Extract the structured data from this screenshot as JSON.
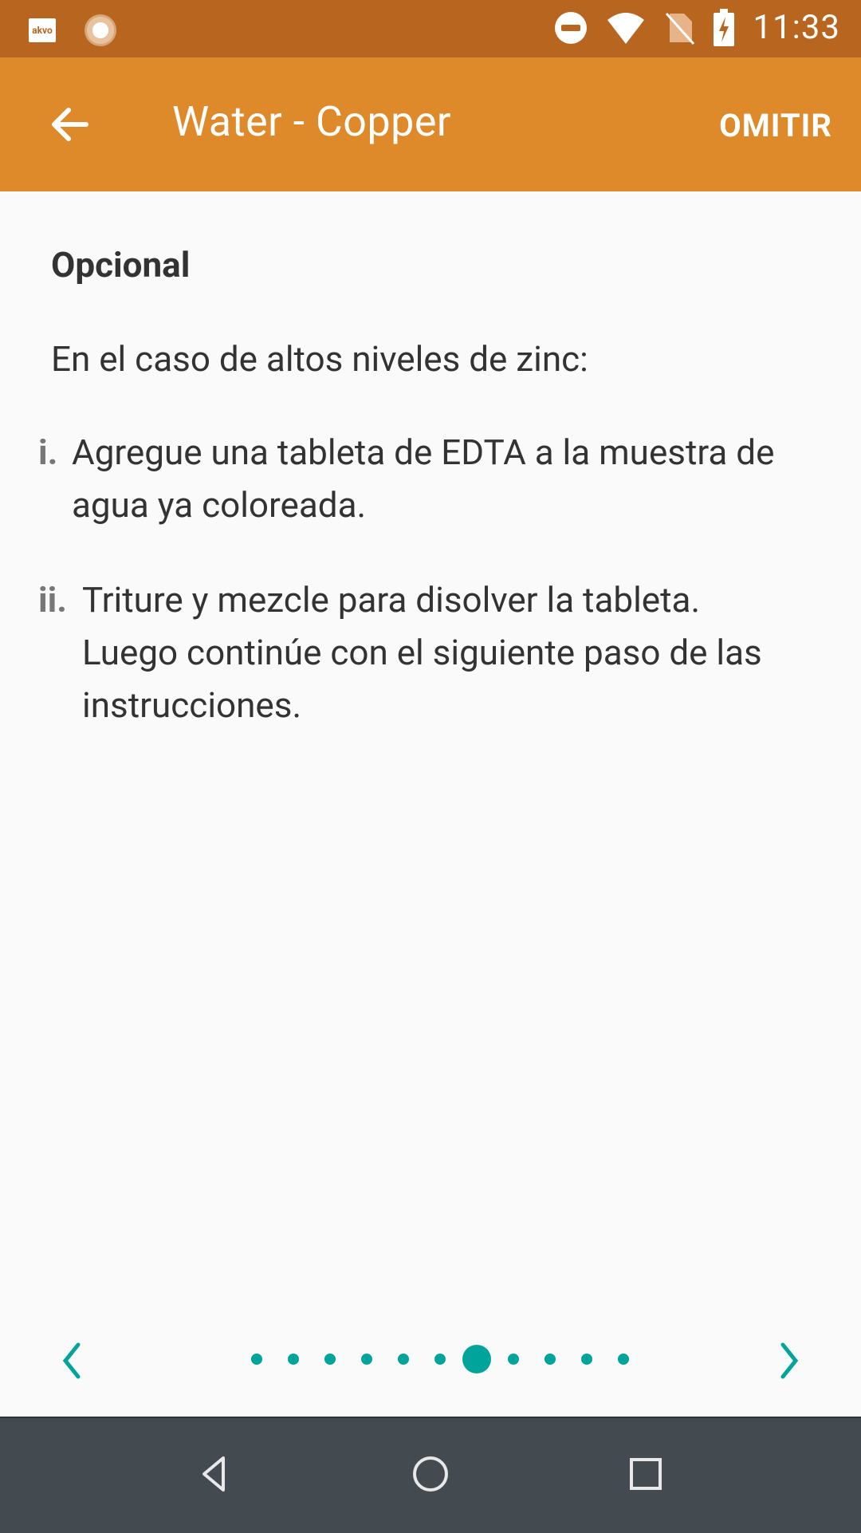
{
  "status_bar": {
    "time": "11:33",
    "left_icons": [
      "akvo-app-icon",
      "loading-app-icon"
    ],
    "akvo_label": "akvo",
    "right_icons": [
      "do-not-disturb-icon",
      "wifi-icon",
      "no-sim-icon",
      "battery-charging-icon"
    ]
  },
  "toolbar": {
    "title": "Water - Copper",
    "skip_label": "OMITIR",
    "back_icon": "arrow-back-icon",
    "color": "#DE8A2B"
  },
  "content": {
    "optional_title": "Opcional",
    "intro": "En el caso de altos niveles de zinc:",
    "items": [
      {
        "marker": "i.",
        "text": "Agregue una tableta de EDTA a la muestra de agua ya coloreada."
      },
      {
        "marker": "ii.",
        "text": "Triture y mezcle para disolver la tableta. Luego continúe con el siguiente paso de las instrucciones."
      }
    ]
  },
  "pager": {
    "total_pages": 11,
    "current_page": 7,
    "prev_icon": "chevron-left-icon",
    "next_icon": "chevron-right-icon",
    "accent_color": "#00A49A"
  },
  "nav_bar": {
    "buttons": [
      "back-triangle-icon",
      "home-circle-icon",
      "recents-square-icon"
    ],
    "color": "#434A50"
  }
}
